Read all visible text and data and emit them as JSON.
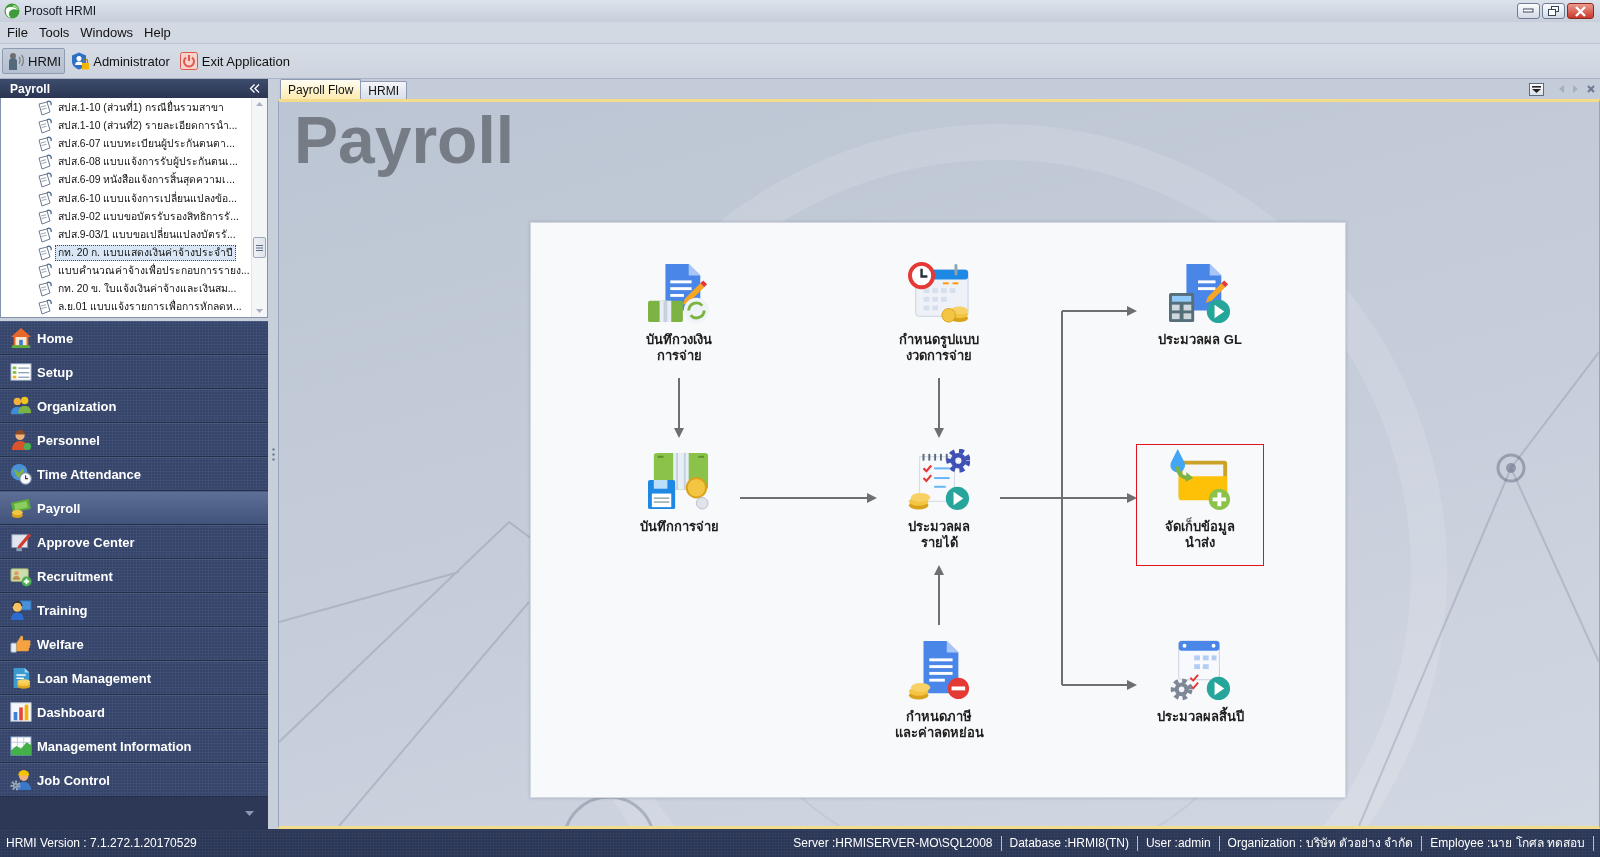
{
  "window": {
    "title": "Prosoft HRMI"
  },
  "menu_bar": [
    "File",
    "Tools",
    "Windows",
    "Help"
  ],
  "toolbar": [
    {
      "label": "HRMI",
      "selected": true
    },
    {
      "label": "Administrator",
      "selected": false
    },
    {
      "label": "Exit Application",
      "selected": false
    }
  ],
  "sidebar": {
    "title": "Payroll",
    "tree_items": [
      {
        "label": "สปส.1-10 (ส่วนที่1) กรณียื่นรวมสาขา",
        "selected": false
      },
      {
        "label": "สปส.1-10 (ส่วนที่2) รายละเอียดการนำ...",
        "selected": false
      },
      {
        "label": "สปส.6-07 แบบทะเบียนผู้ประกันตนตา...",
        "selected": false
      },
      {
        "label": "สปส.6-08 แบบแจ้งการรับผู้ประกันตนเ...",
        "selected": false
      },
      {
        "label": "สปส.6-09 หนังสือแจ้งการสิ้นสุดความเ...",
        "selected": false
      },
      {
        "label": "สปส.6-10 แบบแจ้งการเปลี่ยนแปลงข้อ...",
        "selected": false
      },
      {
        "label": "สปส.9-02 แบบขอบัตรรับรองสิทธิการรั...",
        "selected": false
      },
      {
        "label": "สปส.9-03/1 แบบขอเปลี่ยนแปลงบัตรรั...",
        "selected": false
      },
      {
        "label": "กท. 20 ก. แบบแสดงเงินค่าจ้างประจำปี",
        "selected": true
      },
      {
        "label": "แบบคำนวณค่าจ้างเพื่อประกอบการรายง...",
        "selected": false
      },
      {
        "label": "กท. 20 ข. ใบแจ้งเงินค่าจ้างและเงินสม...",
        "selected": false
      },
      {
        "label": "ล.ย.01 แบบแจ้งรายการเพื่อการหักลดห...",
        "selected": false
      }
    ],
    "nav_items": [
      {
        "label": "Home",
        "selected": false
      },
      {
        "label": "Setup",
        "selected": false
      },
      {
        "label": "Organization",
        "selected": false
      },
      {
        "label": "Personnel",
        "selected": false
      },
      {
        "label": "Time Attendance",
        "selected": false
      },
      {
        "label": "Payroll",
        "selected": true
      },
      {
        "label": "Approve Center",
        "selected": false
      },
      {
        "label": "Recruitment",
        "selected": false
      },
      {
        "label": "Training",
        "selected": false
      },
      {
        "label": "Welfare",
        "selected": false
      },
      {
        "label": "Loan Management",
        "selected": false
      },
      {
        "label": "Dashboard",
        "selected": false
      },
      {
        "label": "Management Information",
        "selected": false
      },
      {
        "label": "Job Control",
        "selected": false
      }
    ]
  },
  "tabs": [
    {
      "label": "Payroll Flow",
      "selected": true
    },
    {
      "label": "HRMI",
      "selected": false
    }
  ],
  "flow": {
    "title": "Payroll",
    "nodes": [
      {
        "label": "บันทึกวงเงิน\nการจ่าย",
        "selected": false
      },
      {
        "label": "กำหนดรูปแบบ\nงวดการจ่าย",
        "selected": false
      },
      {
        "label": "ประมวลผล GL",
        "selected": false
      },
      {
        "label": "บันทึกการจ่าย",
        "selected": false
      },
      {
        "label": "ประมวลผล\nรายได้",
        "selected": false
      },
      {
        "label": "จัดเก็บข้อมูล\nนำส่ง",
        "selected": true
      },
      {
        "label": "กำหนดภาษี\nและค่าลดหย่อน",
        "selected": false
      },
      {
        "label": "ประมวลผลสิ้นปี",
        "selected": false
      }
    ]
  },
  "status_bar": {
    "version": "HRMI Version : 7.1.272.1.20170529",
    "fields": [
      "Server :HRMISERVER-MO\\SQL2008",
      "Database :HRMI8(TN)",
      "User :admin",
      "Organization : บริษัท ตัวอย่าง จำกัด",
      "Employee :นาย โกศล ทดสอบ"
    ]
  }
}
